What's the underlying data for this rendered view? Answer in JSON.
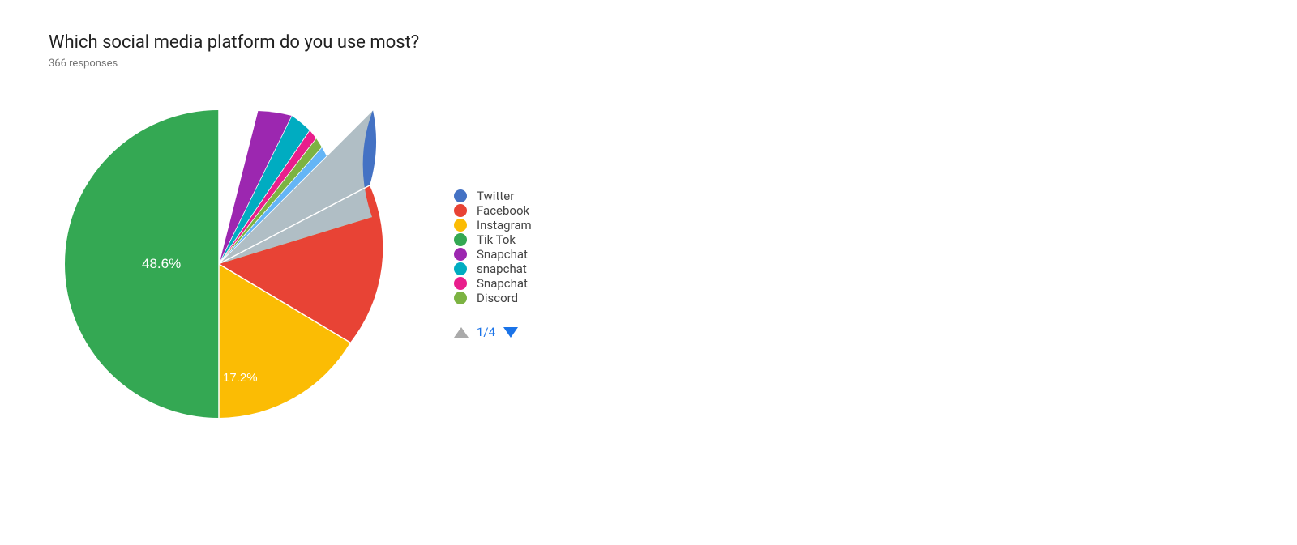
{
  "chart": {
    "title": "Which social media platform do you use most?",
    "subtitle": "366 responses",
    "labels": {
      "tiktok_percent": "48.6%",
      "instagram_percent": "17.2%"
    },
    "legend": {
      "items": [
        {
          "label": "Twitter",
          "color": "#4472c4"
        },
        {
          "label": "Facebook",
          "color": "#e84335"
        },
        {
          "label": "Instagram",
          "color": "#fbbc04"
        },
        {
          "label": "Tik Tok",
          "color": "#34a853"
        },
        {
          "label": "Snapchat",
          "color": "#9c27b0"
        },
        {
          "label": "snapchat",
          "color": "#00acc1"
        },
        {
          "label": "Snapchat",
          "color": "#e91e8c"
        },
        {
          "label": "Discord",
          "color": "#7cb342"
        }
      ],
      "pagination": "1/4"
    }
  }
}
